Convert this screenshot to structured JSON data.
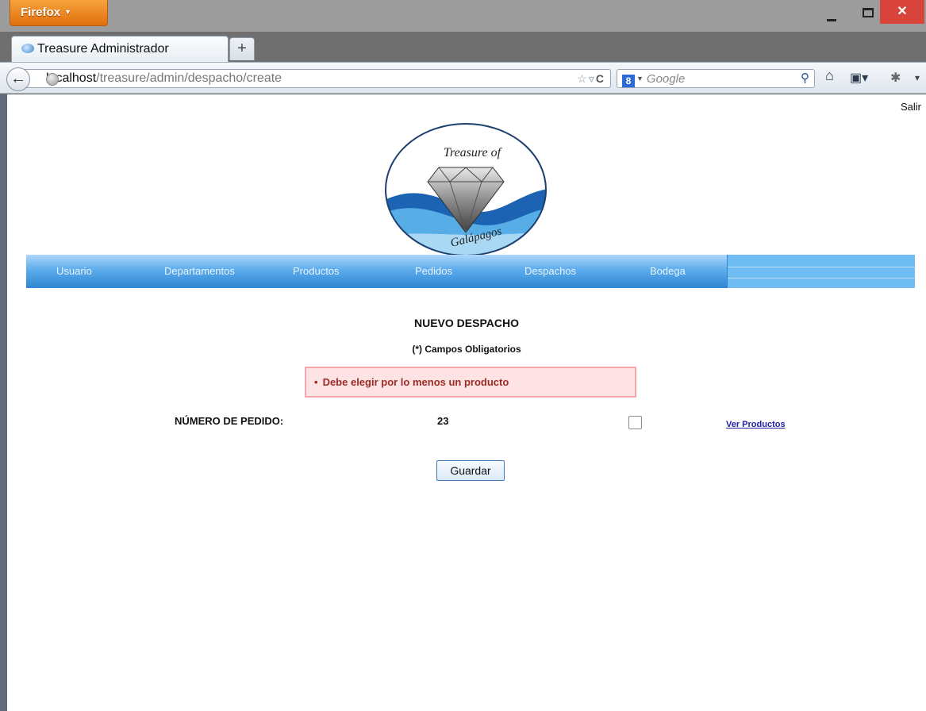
{
  "browser": {
    "menu_button_label": "Firefox",
    "window_controls": {
      "minimize": "",
      "maximize": "",
      "close": "✕"
    },
    "tab": {
      "title": "Treasure Administrador",
      "new_tab_label": "+"
    },
    "url": {
      "host": "localhost",
      "path": "/treasure/admin/despacho/create"
    },
    "search": {
      "placeholder": "Google",
      "engine_letter": "8"
    }
  },
  "page": {
    "logout_label": "Salir",
    "logo": {
      "top_text": "Treasure of",
      "bottom_text": "Galápagos"
    },
    "nav": {
      "items": [
        {
          "label": "Usuario"
        },
        {
          "label": "Departamentos"
        },
        {
          "label": "Productos"
        },
        {
          "label": "Pedidos"
        },
        {
          "label": "Despachos"
        },
        {
          "label": "Bodega"
        }
      ]
    },
    "form": {
      "title": "NUEVO DESPACHO",
      "subtitle": "(*) Campos Obligatorios",
      "error_message": "Debe elegir por lo menos un producto",
      "pedido_label": "NÚMERO DE PEDIDO:",
      "pedido_value": "23",
      "checkbox_checked": false,
      "ver_productos_label": "Ver Productos",
      "save_label": "Guardar"
    }
  },
  "colors": {
    "menu_gradient_top": "#aed7fb",
    "menu_gradient_bottom": "#2f86d0",
    "error_bg": "#fde3e4",
    "error_border": "#f3a6ac",
    "error_text": "#9c2b25",
    "firefox_orange": "#e06f0f"
  }
}
